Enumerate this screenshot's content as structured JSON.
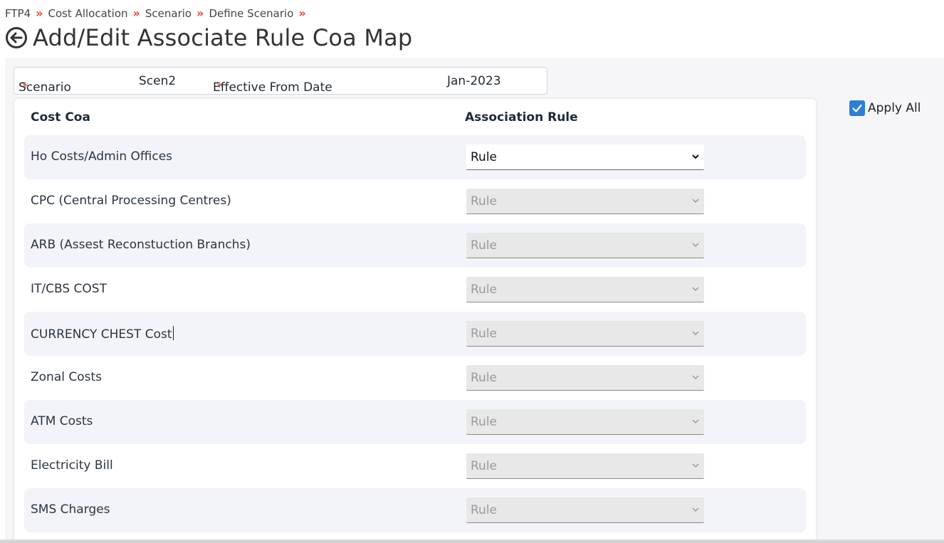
{
  "breadcrumb": {
    "items": [
      "FTP4",
      "Cost Allocation",
      "Scenario",
      "Define Scenario"
    ],
    "separator": "»"
  },
  "page": {
    "title": "Add/Edit Associate Rule Coa Map",
    "back_icon": "back-circle-arrow-icon"
  },
  "header": {
    "scenario_label": "Scenario",
    "scenario_value": "Scen2",
    "effective_label": "Effective From Date",
    "effective_value": "Jan-2023",
    "required_mark": "*"
  },
  "table": {
    "col_cost_coa": "Cost Coa",
    "col_association_rule": "Association Rule",
    "rows": [
      {
        "cost_coa": "Ho Costs/Admin Offices",
        "rule": "Rule",
        "enabled": true
      },
      {
        "cost_coa": "CPC (Central Processing Centres)",
        "rule": "Rule",
        "enabled": false
      },
      {
        "cost_coa": "ARB (Assest Reconstuction Branchs)",
        "rule": "Rule",
        "enabled": false
      },
      {
        "cost_coa": "IT/CBS COST",
        "rule": "Rule",
        "enabled": false
      },
      {
        "cost_coa": "CURRENCY CHEST Cost",
        "rule": "Rule",
        "enabled": false
      },
      {
        "cost_coa": "Zonal Costs",
        "rule": "Rule",
        "enabled": false
      },
      {
        "cost_coa": "ATM Costs",
        "rule": "Rule",
        "enabled": false
      },
      {
        "cost_coa": "Electricity Bill",
        "rule": "Rule",
        "enabled": false
      },
      {
        "cost_coa": "SMS Charges",
        "rule": "Rule",
        "enabled": false
      }
    ]
  },
  "apply_all": {
    "label": "Apply All",
    "checked": true
  },
  "colors": {
    "accent": "#2b7fd8",
    "required": "#d9452b",
    "row_shade": "#f2f4fa"
  }
}
